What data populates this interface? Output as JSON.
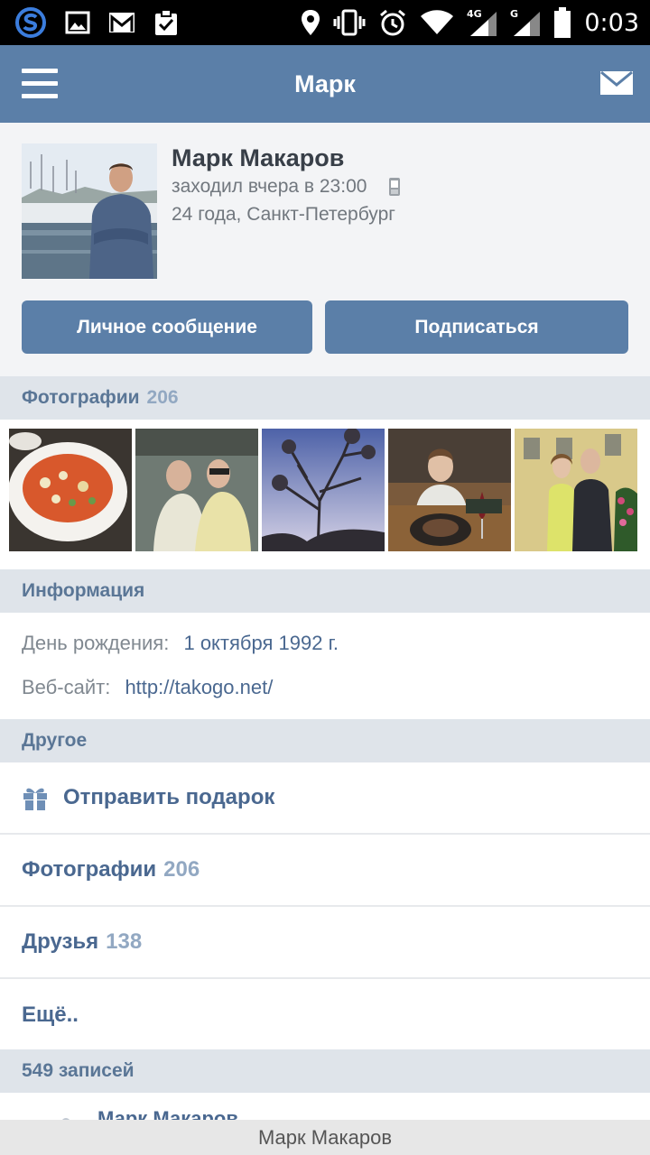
{
  "status_bar": {
    "time": "0:03",
    "icons": [
      "app-s-icon",
      "gallery-icon",
      "gmail-icon",
      "clipboard-check-icon",
      "location-icon",
      "vibrate-icon",
      "alarm-icon",
      "wifi-icon",
      "signal-4g-icon",
      "signal-g-icon",
      "battery-icon"
    ]
  },
  "header": {
    "title": "Марк",
    "menu_icon": "menu-icon",
    "mail_icon": "mail-icon"
  },
  "profile": {
    "name": "Марк Макаров",
    "last_seen": "заходил вчера в 23:00",
    "location": "24 года, Санкт-Петербург",
    "message_button": "Личное сообщение",
    "subscribe_button": "Подписаться"
  },
  "photos_section": {
    "label": "Фотографии",
    "count": "206"
  },
  "info_section": {
    "label": "Информация",
    "birthday_label": "День рождения:",
    "birthday_value": "1 октября 1992 г.",
    "website_label": "Веб-сайт:",
    "website_value": "http://takogo.net/"
  },
  "other_section": {
    "label": "Другое",
    "gift": "Отправить подарок",
    "photos_label": "Фотографии",
    "photos_count": "206",
    "friends_label": "Друзья",
    "friends_count": "138",
    "more": "Ещё.."
  },
  "posts_section": {
    "label": "549 записей",
    "first_post_author": "Марк Макаров"
  },
  "bottom_bar": {
    "text": "Марк Макаров"
  },
  "colors": {
    "brand": "#5b7fa8",
    "section_bg": "#dfe4ea",
    "link": "#4a6890"
  }
}
